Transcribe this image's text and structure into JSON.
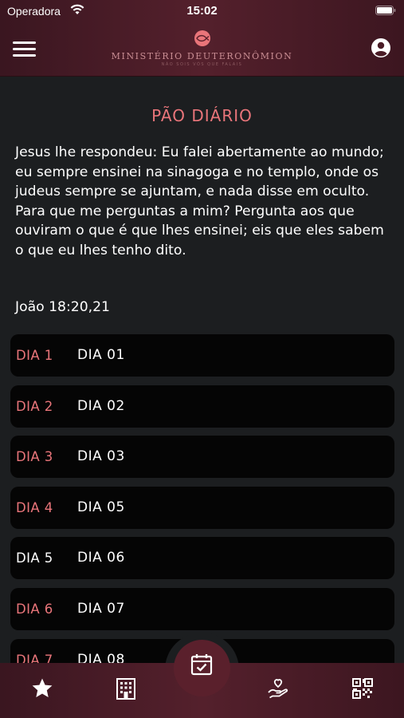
{
  "status_bar": {
    "carrier": "Operadora",
    "time": "15:02"
  },
  "header": {
    "logo_text": "MINISTÉRIO DEUTERONÔMION",
    "logo_sub": "NÃO SOIS VÓS QUE FALAIS"
  },
  "content": {
    "title": "PÃO DIÁRIO",
    "verse": "Jesus lhe respondeu: Eu falei abertamente ao mundo; eu sempre ensinei na sinagoga e no templo, onde os judeus sempre se ajuntam, e nada disse em oculto.\nPara que me perguntas a mim? Pergunta aos que ouviram o que é que lhes ensinei; eis que eles sabem o que eu lhes tenho dito.",
    "reference": "João 18:20,21"
  },
  "days": [
    {
      "label": "DIA 1",
      "title": "DIA 01",
      "highlight": true
    },
    {
      "label": "DIA 2",
      "title": "DIA 02",
      "highlight": true
    },
    {
      "label": "DIA 3",
      "title": "DIA 03",
      "highlight": true
    },
    {
      "label": "DIA 4",
      "title": "DIA 05",
      "highlight": true
    },
    {
      "label": "DIA 5",
      "title": "DIA 06",
      "highlight": false
    },
    {
      "label": "DIA 6",
      "title": "DIA 07",
      "highlight": true
    },
    {
      "label": "DIA 7",
      "title": "DIA 08",
      "highlight": true
    }
  ],
  "tabbar": {
    "tabs": [
      "star-icon",
      "building-icon",
      "calendar-check-icon",
      "hand-heart-icon",
      "qr-code-icon"
    ],
    "active": "calendar-check-icon"
  },
  "colors": {
    "accent": "#e9757a",
    "header": "#54202c",
    "background": "#1c1e20",
    "card": "#050505"
  }
}
